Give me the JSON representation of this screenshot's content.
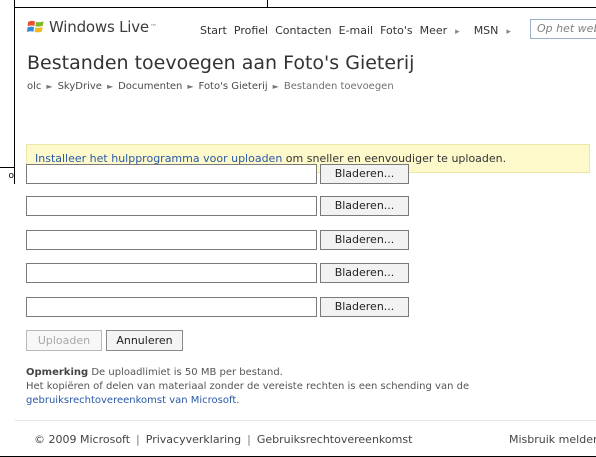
{
  "background": {
    "stub_text": "o"
  },
  "header": {
    "brand": "Windows Live",
    "brand_tm": "™",
    "nav": [
      "Start",
      "Profiel",
      "Contacten",
      "E-mail",
      "Foto's",
      "Meer",
      "MSN"
    ],
    "search_placeholder": "Op het web"
  },
  "page": {
    "title": "Bestanden toevoegen aan Foto's Gieterij",
    "breadcrumb": [
      "olc",
      "SkyDrive",
      "Documenten",
      "Foto's Gieterij",
      "Bestanden toevoegen"
    ]
  },
  "info": {
    "link": "Installeer het hulpprogramma voor uploaden",
    "text": " om sneller en eenvoudiger te uploaden."
  },
  "uploads": {
    "browse_label": "Bladeren...",
    "rows": [
      {
        "value": ""
      },
      {
        "value": ""
      },
      {
        "value": ""
      },
      {
        "value": ""
      },
      {
        "value": ""
      }
    ]
  },
  "actions": {
    "upload": "Uploaden",
    "cancel": "Annuleren"
  },
  "note": {
    "title": "Opmerking",
    "text1": " De uploadlimiet is 50 MB per bestand.",
    "text2": "Het kopiëren of delen van materiaal zonder de vereiste rechten is een schending van de",
    "link": "gebruiksrechtovereenkomst van Microsoft",
    "end": "."
  },
  "footer": {
    "copyright": "© 2009 Microsoft",
    "privacy": "Privacyverklaring",
    "terms": "Gebruiksrechtovereenkomst",
    "abuse": "Misbruik melden"
  },
  "colors": {
    "accent_link": "#2859a8",
    "info_background": "#fdf9cb"
  }
}
